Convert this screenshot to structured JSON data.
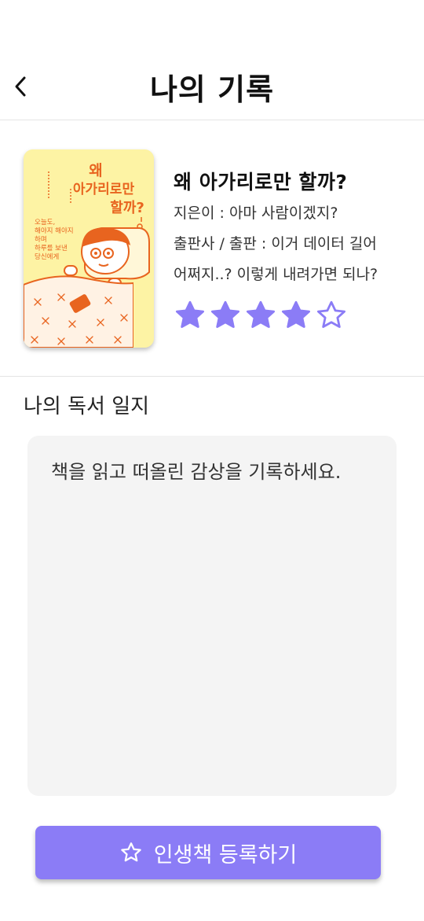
{
  "header": {
    "title": "나의 기록"
  },
  "book": {
    "title": "왜 아가리로만 할까?",
    "author_label": "지은이 :",
    "author": "아마 사람이겠지?",
    "publisher_label": "출판사 / 출판 :",
    "publisher_line1": "이거 데이터 길어",
    "publisher_line2": "어쩌지..? 이렇게 내려가면 되나?",
    "rating": 4,
    "rating_max": 5,
    "cover": {
      "title_line1": "왜",
      "title_line2": "아가리로만",
      "title_line3": "할까?",
      "blurb_line1": "오늘도,",
      "blurb_line2": "해야지 해야지",
      "blurb_line3": "하며",
      "blurb_line4": "하루를 보낸",
      "blurb_line5": "당신에게",
      "accent_color": "#e8641f",
      "bg_color": "#fdf3a4"
    }
  },
  "journal": {
    "heading": "나의 독서 일지",
    "placeholder": "책을 읽고 떠올린 감상을 기록하세요.",
    "value": ""
  },
  "actions": {
    "register_label": "인생책 등록하기"
  },
  "colors": {
    "accent": "#8b7cf6",
    "star": "#8b7cf6",
    "journal_bg": "#f4f4f4"
  }
}
